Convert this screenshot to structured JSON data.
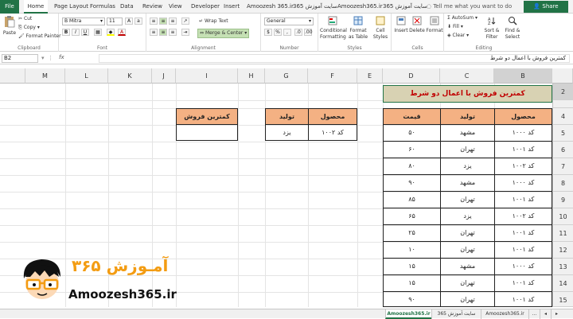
{
  "ribbon_tabs": [
    "File",
    "Home",
    "Page Layout",
    "Formulas",
    "Data",
    "Review",
    "View",
    "Developer",
    "Insert",
    "Amoozesh 365.ir",
    "سایت آموزش 365",
    "Amoozesh365.ir",
    "سایت آموزش 365"
  ],
  "tell_me": "Tell me what you want to do",
  "share": "Share",
  "clipboard": {
    "paste": "Paste",
    "cut": "Cut",
    "copy": "Copy",
    "format_painter": "Format Painter",
    "label": "Clipboard"
  },
  "font": {
    "name": "B Mitra",
    "size": "11",
    "label": "Font",
    "bold": "B",
    "italic": "I",
    "underline": "U"
  },
  "alignment": {
    "wrap": "Wrap Text",
    "merge": "Merge & Center",
    "label": "Alignment"
  },
  "number": {
    "format": "General",
    "label": "Number",
    "percent": "%",
    "comma": ","
  },
  "styles": {
    "conditional": "Conditional Formatting",
    "format_table": "Format as Table",
    "cell_styles": "Cell Styles",
    "label": "Styles"
  },
  "cells": {
    "insert": "Insert",
    "delete": "Delete",
    "format": "Format",
    "label": "Cells"
  },
  "editing": {
    "autosum": "AutoSum",
    "fill": "Fill",
    "clear": "Clear",
    "sort": "Sort & Filter",
    "find": "Find & Select",
    "label": "Editing"
  },
  "formula_bar": {
    "name_box": "B2",
    "fx": "fx",
    "content": "کمترین فروش با اعمال دو شرط"
  },
  "columns": [
    "B",
    "C",
    "D",
    "E",
    "F",
    "G",
    "H",
    "I",
    "J",
    "K",
    "L",
    "M"
  ],
  "rows": [
    "2",
    "4",
    "5",
    "6",
    "7",
    "8",
    "9",
    "10",
    "11",
    "12",
    "13",
    "14",
    "15"
  ],
  "title": "کمترین فروش با اعمال دو شرط",
  "main_table": {
    "headers": [
      "محصول",
      "تولید",
      "قیمت"
    ],
    "rows": [
      [
        "کد ۱۰۰۰",
        "مشهد",
        "۵۰"
      ],
      [
        "کد ۱۰۰۱",
        "تهران",
        "۶۰"
      ],
      [
        "کد ۱۰۰۲",
        "یزد",
        "۸۰"
      ],
      [
        "کد ۱۰۰۰",
        "مشهد",
        "۹۰"
      ],
      [
        "کد ۱۰۰۱",
        "تهران",
        "۸۵"
      ],
      [
        "کد ۱۰۰۲",
        "یزد",
        "۶۵"
      ],
      [
        "کد ۱۰۰۱",
        "تهران",
        "۲۵"
      ],
      [
        "کد ۱۰۰۱",
        "تهران",
        "۱۰"
      ],
      [
        "کد ۱۰۰۰",
        "مشهد",
        "۱۵"
      ],
      [
        "کد ۱۰۰۱",
        "تهران",
        "۱۵"
      ],
      [
        "کد ۱۰۰۱",
        "تهران",
        "۹۰"
      ]
    ]
  },
  "criteria_table": {
    "headers": [
      "محصول",
      "تولید"
    ],
    "row": [
      "کد ۱۰۰۲",
      "یزد"
    ]
  },
  "result_table": {
    "header": "کمترین فروش",
    "value": ""
  },
  "logo": {
    "fa": "آمـوزش ۳۶۵",
    "en": "Amoozesh365.ir"
  },
  "sheet_tabs": [
    "Amoozesh365.ir",
    "سایت آموزش 365",
    "Amoozesh365.ir"
  ]
}
